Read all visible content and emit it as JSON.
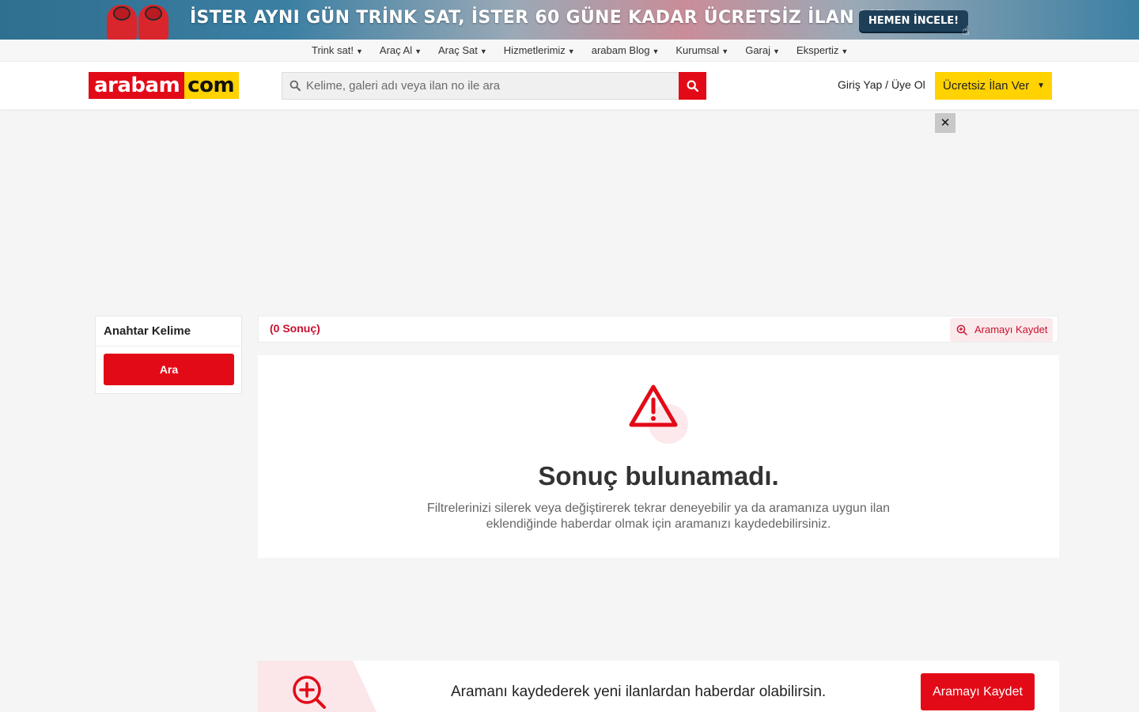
{
  "promo": {
    "text": "İSTER AYNI GÜN TRİNK SAT, İSTER 60 GÜNE KADAR ÜCRETSİZ İLAN VER.",
    "button_label": "HEMEN İNCELE!"
  },
  "nav": {
    "items": [
      {
        "label": "Trink sat!"
      },
      {
        "label": "Araç Al"
      },
      {
        "label": "Araç Sat"
      },
      {
        "label": "Hizmetlerimiz"
      },
      {
        "label": "arabam Blog"
      },
      {
        "label": "Kurumsal"
      },
      {
        "label": "Garaj"
      },
      {
        "label": "Ekspertiz"
      }
    ],
    "caret": "▼"
  },
  "header": {
    "logo_left": "arabam",
    "logo_right": "com",
    "search_placeholder": "Kelime, galeri adı veya ilan no ile ara",
    "login_label": "Giriş Yap / Üye Ol",
    "post_button_label": "Ücretsiz İlan Ver",
    "post_caret": "▼"
  },
  "ad": {
    "close_symbol": "✕"
  },
  "sidebar": {
    "title": "Anahtar Kelime",
    "search_button": "Ara"
  },
  "results": {
    "count_label": "(0 Sonuç)",
    "save_search_label": "Aramayı Kaydet"
  },
  "empty_state": {
    "heading": "Sonuç bulunamadı.",
    "description": "Filtrelerinizi silerek veya değiştirerek tekrar deneyebilir ya da aramanıza uygun ilan eklendiğinde haberdar olmak için aramanızı kaydedebilirsiniz."
  },
  "save_promo": {
    "message": "Aramanı kaydederek yeni ilanlardan haberdar olabilirsin.",
    "button_label": "Aramayı Kaydet"
  },
  "colors": {
    "brand_red": "#e30a17",
    "brand_yellow": "#ffd200",
    "accent_red_text": "#c8102e"
  },
  "icons": {
    "search": "search-icon",
    "warning": "warning-triangle-icon",
    "zoom_in": "zoom-in-icon",
    "close": "close-icon"
  }
}
